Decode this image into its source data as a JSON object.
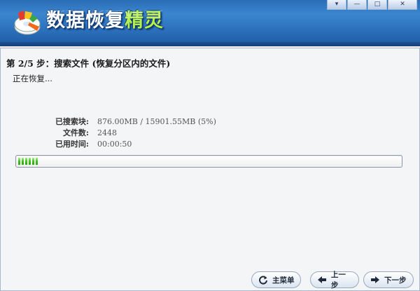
{
  "app": {
    "title_main": "数据恢复",
    "title_accent": "精灵"
  },
  "window_controls": [
    "▾",
    "—",
    "□",
    "✕"
  ],
  "step": {
    "title": "第 2/5 步：搜索文件 (恢复分区内的文件)",
    "status": "正在恢复..."
  },
  "stats": [
    {
      "label": "已搜索块:",
      "value": "876.00MB / 15901.55MB (5%)"
    },
    {
      "label": "文件数:",
      "value": "2448"
    },
    {
      "label": "已用时间:",
      "value": "00:00:50"
    }
  ],
  "progress": {
    "fraction": 0.055,
    "color": "#3cc31b"
  },
  "buttons": {
    "main_menu": "主菜单",
    "prev": "上一步",
    "next": "下一步"
  },
  "icons": {
    "logo": "data-recovery-logo",
    "main_menu": "refresh-icon",
    "prev": "arrow-left-icon",
    "next": "arrow-right-icon"
  }
}
